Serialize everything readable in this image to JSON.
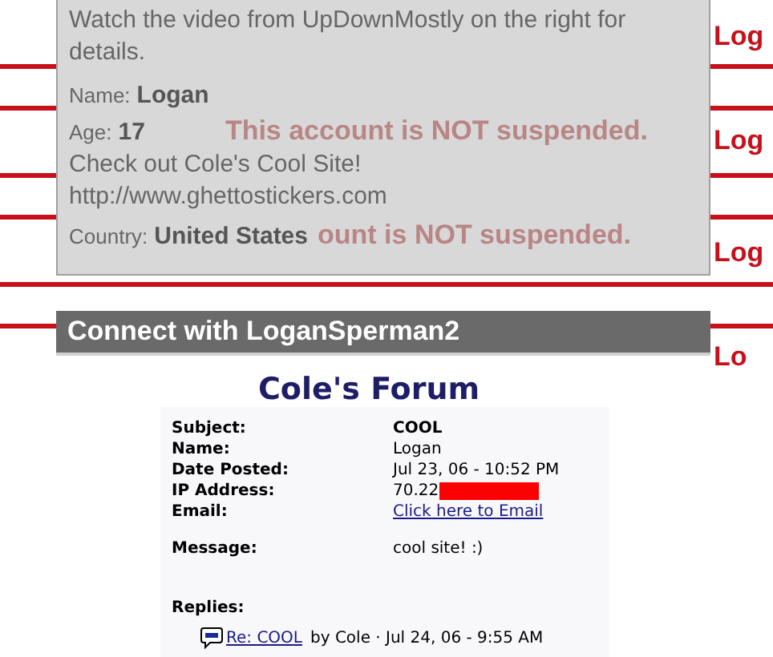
{
  "profile_card": {
    "intro": "Watch the video from UpDownMostly on the right for details.",
    "fields": [
      {
        "label": "Name:",
        "value": "Logan"
      },
      {
        "label": "Age:",
        "value": "17",
        "note": "This account is NOT suspended."
      }
    ],
    "about": "Check out Cole's Cool Site!",
    "link": "http://www.ghettostickers.com",
    "country": {
      "label": "Country:",
      "value": "United States",
      "note": "ount is NOT suspended."
    }
  },
  "connect_bar": {
    "title": "Connect with LoganSperman2"
  },
  "side_links": [
    "Log",
    "Log",
    "Log",
    "Lo"
  ],
  "forum": {
    "title": "Cole's Forum",
    "rows": [
      {
        "label": "Subject:",
        "value": "COOL",
        "kind": "bold"
      },
      {
        "label": "Name:",
        "value": "Logan",
        "kind": "plain"
      },
      {
        "label": "Date Posted:",
        "value": "Jul 23, 06 - 10:52 PM",
        "kind": "plain"
      },
      {
        "label": "IP Address:",
        "value": "70.22",
        "kind": "redacted"
      },
      {
        "label": "Email:",
        "value": "Click here to Email",
        "kind": "link"
      }
    ],
    "message": {
      "label": "Message:",
      "value": "cool site! :)"
    },
    "replies_label": "Replies:",
    "replies": [
      {
        "title": "Re: COOL",
        "meta": "by Cole · Jul 24, 06 - 9:55 AM"
      }
    ]
  }
}
